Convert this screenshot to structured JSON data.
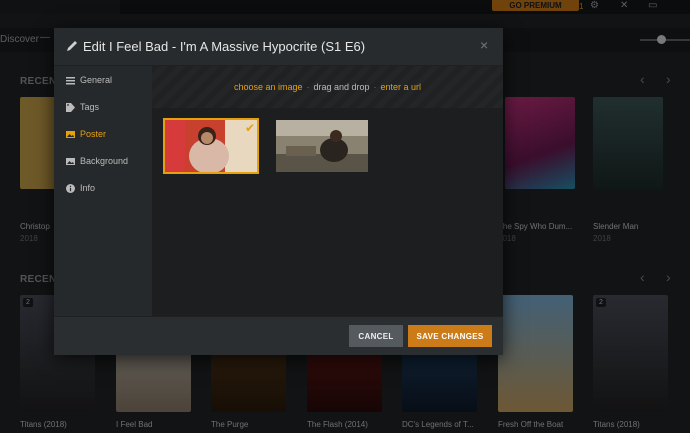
{
  "topbar": {
    "premium_label": "GO PREMIUM",
    "notification_count": "1"
  },
  "nav": {
    "discover_label": "Discover",
    "separator": "—"
  },
  "sections": [
    {
      "title": "RECENT",
      "items": [
        {
          "title": "Christop",
          "year": "2018",
          "color": "#c9a24a"
        },
        {
          "title": "The Spy Who Dum...",
          "year": "2018",
          "color": "#c2307a"
        },
        {
          "title": "Slender Man",
          "year": "2018",
          "color": "#2c3f3e"
        }
      ]
    },
    {
      "title": "RECENT",
      "items": [
        {
          "title": "Titans (2018)",
          "badge": "2",
          "color": "#3b3d4a"
        },
        {
          "title": "I Feel Bad",
          "color": "#c7c2b8"
        },
        {
          "title": "The Purge",
          "color": "#5a3a1c"
        },
        {
          "title": "The Flash (2014)",
          "color": "#7a1f1f"
        },
        {
          "title": "DC's Legends of T...",
          "color": "#1e3a5a"
        },
        {
          "title": "Fresh Off the Boat",
          "color": "#4a7fb0"
        },
        {
          "title": "Titans (2018)",
          "badge": "2",
          "color": "#3b3d4a"
        }
      ]
    }
  ],
  "modal": {
    "title": "Edit I Feel Bad - I'm A Massive Hypocrite (S1 E6)",
    "close_label": "×",
    "sidebar": [
      {
        "label": "General",
        "icon": "list-icon"
      },
      {
        "label": "Tags",
        "icon": "tag-icon"
      },
      {
        "label": "Poster",
        "icon": "image-icon",
        "active": true
      },
      {
        "label": "Background",
        "icon": "image-icon"
      },
      {
        "label": "Info",
        "icon": "info-icon"
      }
    ],
    "dropzone": {
      "choose": "choose an image",
      "drag": "drag and drop",
      "url": "enter a url"
    },
    "buttons": {
      "cancel": "CANCEL",
      "save": "SAVE CHANGES"
    }
  },
  "colors": {
    "accent": "#e5a00d",
    "save_button": "#cc7b19",
    "cancel_button": "#555a5e"
  }
}
